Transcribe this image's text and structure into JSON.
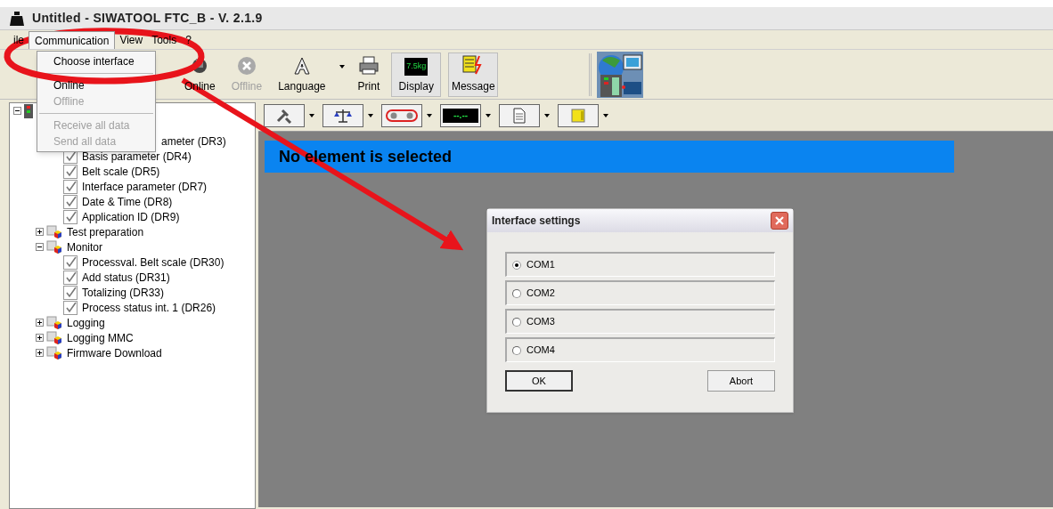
{
  "window": {
    "title": "Untitled - SIWATOOL FTC_B - V. 2.1.9"
  },
  "menu_bar": [
    {
      "label": "ile",
      "selected": false
    },
    {
      "label": "Communication",
      "selected": true
    },
    {
      "label": "View",
      "selected": false
    },
    {
      "label": "Tools",
      "selected": false
    },
    {
      "label": "?",
      "selected": false
    }
  ],
  "open_menu": {
    "items": [
      {
        "kind": "item",
        "label": "Choose interface",
        "disabled": false
      },
      {
        "kind": "separator"
      },
      {
        "kind": "item",
        "label": "Online",
        "disabled": false
      },
      {
        "kind": "item",
        "label": "Offline",
        "disabled": true
      },
      {
        "kind": "separator"
      },
      {
        "kind": "item",
        "label": "Receive all data",
        "disabled": true
      },
      {
        "kind": "item",
        "label": "Send all data",
        "disabled": true
      }
    ]
  },
  "toolbar": [
    {
      "kind": "online",
      "label": "Online",
      "disabled": false,
      "pressed": false
    },
    {
      "kind": "offline",
      "label": "Offline",
      "disabled": true,
      "pressed": false
    },
    {
      "kind": "language",
      "label": "Language",
      "disabled": false,
      "pressed": false
    },
    {
      "kind": "print",
      "label": "Print",
      "disabled": false,
      "pressed": false
    },
    {
      "kind": "display",
      "label": "Display",
      "screen_text": "7.5kg",
      "disabled": false,
      "pressed": true
    },
    {
      "kind": "message",
      "label": "Message",
      "disabled": false,
      "pressed": true
    }
  ],
  "tree": {
    "children": [
      {
        "expanded": true,
        "kind": "device",
        "children": [
          {
            "kind": "hidden",
            "children": [
              {
                "kind": "partial",
                "label": "ameter (DR3)"
              },
              {
                "kind": "check",
                "label": "Basis parameter (DR4)",
                "checked": true
              },
              {
                "kind": "check",
                "label": "Belt scale (DR5)",
                "checked": true
              },
              {
                "kind": "check",
                "label": "Interface parameter (DR7)",
                "checked": true
              },
              {
                "kind": "check",
                "label": "Date & Time (DR8)",
                "checked": true
              },
              {
                "kind": "check",
                "label": "Application ID (DR9)",
                "checked": true
              }
            ]
          },
          {
            "kind": "folder",
            "label": "Test preparation",
            "expanded": false
          },
          {
            "kind": "folder",
            "label": "Monitor",
            "expanded": true,
            "children": [
              {
                "kind": "check",
                "label": "Processval. Belt scale (DR30)",
                "checked": true
              },
              {
                "kind": "check",
                "label": "Add status (DR31)",
                "checked": true
              },
              {
                "kind": "check",
                "label": "Totalizing (DR33)",
                "checked": true
              },
              {
                "kind": "check",
                "label": "Process status int. 1 (DR26)",
                "checked": true
              }
            ]
          },
          {
            "kind": "folder",
            "label": "Logging",
            "expanded": false
          },
          {
            "kind": "folder",
            "label": "Logging MMC",
            "expanded": false
          },
          {
            "kind": "folder",
            "label": "Firmware Download",
            "expanded": false
          }
        ]
      }
    ]
  },
  "element_toolbar": [
    {
      "kind": "tools"
    },
    {
      "kind": "scale"
    },
    {
      "kind": "belt"
    },
    {
      "kind": "readout",
      "screen_text": "--.--"
    },
    {
      "kind": "document"
    },
    {
      "kind": "card"
    }
  ],
  "banner": {
    "text": "No element is selected"
  },
  "dialog": {
    "title": "Interface settings",
    "options": [
      {
        "label": "COM1",
        "selected": true
      },
      {
        "label": "COM2",
        "selected": false
      },
      {
        "label": "COM3",
        "selected": false
      },
      {
        "label": "COM4",
        "selected": false
      }
    ],
    "buttons": [
      {
        "label": "OK",
        "focused": true
      },
      {
        "label": "Abort",
        "focused": false
      }
    ]
  }
}
